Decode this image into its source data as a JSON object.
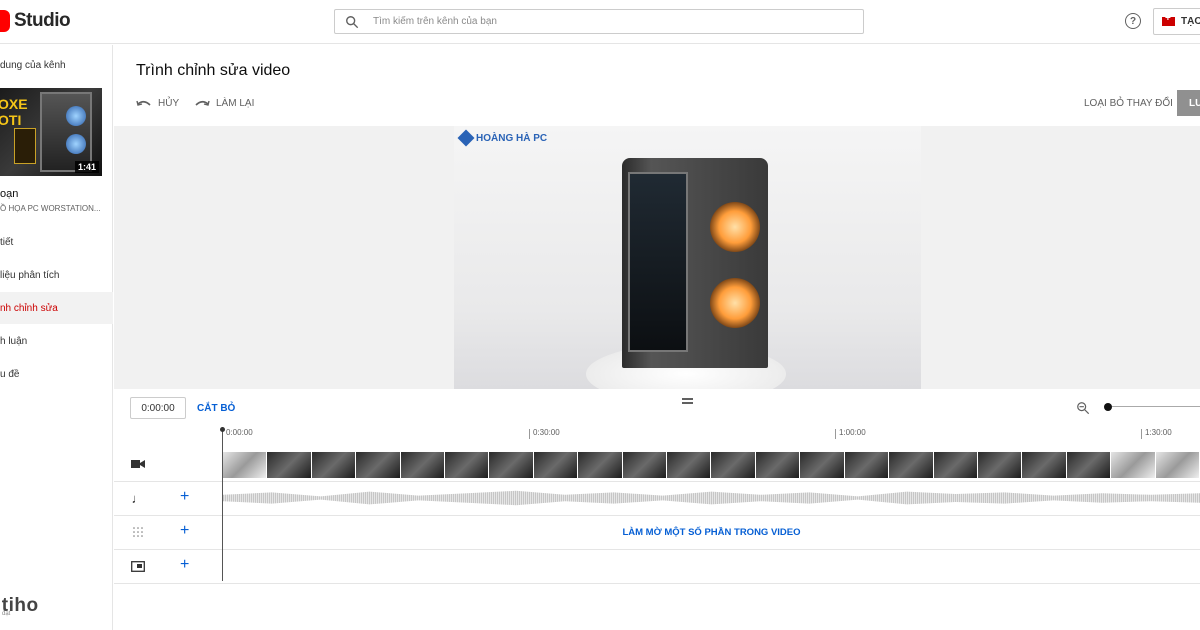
{
  "app": {
    "logo_text": "Studio",
    "brand_color": "#ff0000"
  },
  "search": {
    "placeholder": "Tìm kiếm trên kênh của bạn"
  },
  "header": {
    "help_symbol": "?",
    "create_label": "TẠO"
  },
  "sidebar": {
    "back_label": "dung của kênh",
    "thumbnail": {
      "text": "OXE\nOTI",
      "duration": "1:41"
    },
    "video_title": "oạn",
    "video_subtitle": "Ồ HỌA PC WORSTATION...",
    "items": [
      {
        "label": "tiết",
        "active": false
      },
      {
        "label": "liệu phân tích",
        "active": false
      },
      {
        "label": "nh chỉnh sửa",
        "active": true
      },
      {
        "label": "h luận",
        "active": false
      },
      {
        "label": "u đề",
        "active": false
      }
    ],
    "brand": "itiho",
    "brand_sub": "đạt"
  },
  "editor": {
    "title": "Trình chỉnh sửa video",
    "undo_label": "HỦY",
    "redo_label": "LÀM LẠI",
    "discard_label": "LOẠI BỎ THAY ĐỔI",
    "save_label": "LƯ"
  },
  "preview": {
    "watermark": "HOÀNG HÀ PC"
  },
  "timeline": {
    "current_time": "0:00:00",
    "trim_label": "CẮT BỎ",
    "ticks": [
      "0:00:00",
      "0:30:00",
      "1:00:00",
      "1:30:00"
    ],
    "zoom_level": 0,
    "blur_label": "LÀM MỜ MỘT SỐ PHẦN TRONG VIDEO",
    "accent_color": "#065fd4"
  }
}
